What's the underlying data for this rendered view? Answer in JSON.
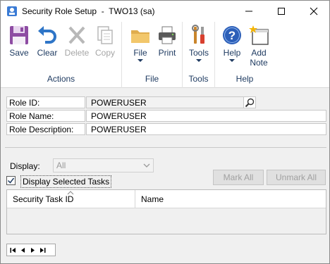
{
  "window": {
    "title": "Security Role Setup  -  TWO13 (sa)"
  },
  "ribbon": {
    "groups": [
      {
        "label": "Actions"
      },
      {
        "label": "File"
      },
      {
        "label": "Tools"
      },
      {
        "label": "Help"
      }
    ],
    "buttons": {
      "save": "Save",
      "clear": "Clear",
      "delete": "Delete",
      "copy": "Copy",
      "file": "File",
      "print": "Print",
      "tools": "Tools",
      "help": "Help",
      "add_note_1": "Add",
      "add_note_2": "Note"
    }
  },
  "form": {
    "role_id_label": "Role ID:",
    "role_id_value": "POWERUSER",
    "role_name_label": "Role Name:",
    "role_name_value": "POWERUSER",
    "role_desc_label": "Role Description:",
    "role_desc_value": "POWERUSER"
  },
  "tasks": {
    "display_label": "Display:",
    "display_value": "All",
    "display_selected_label": "Display Selected Tasks",
    "display_selected_checked": true,
    "mark_all": "Mark All",
    "unmark_all": "Unmark All",
    "columns": [
      "Security Task ID",
      "Name"
    ]
  },
  "colors": {
    "accent": "#1f3b61",
    "save_icon": "#8e4ca3",
    "clear_icon": "#2e75c7",
    "help_icon": "#2c5fb8"
  }
}
